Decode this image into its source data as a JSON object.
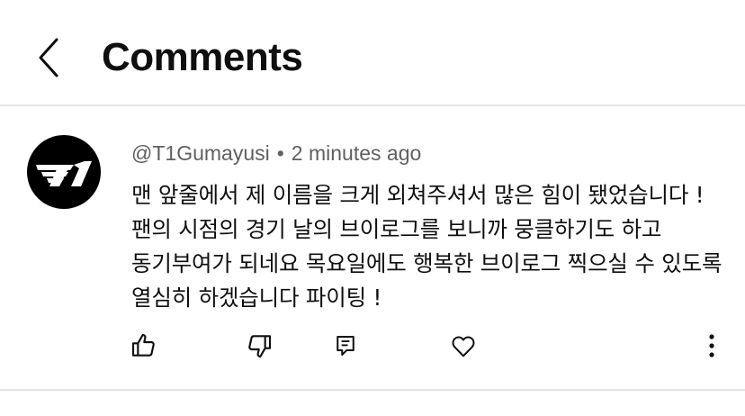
{
  "header": {
    "title": "Comments",
    "back_icon": "chevron-left-icon"
  },
  "comment": {
    "author": "@T1Gumayusi",
    "separator": "•",
    "time": "2 minutes ago",
    "avatar_logo": "t1-logo",
    "text": "맨 앞줄에서 제 이름을 크게 외쳐주셔서 많은 힘이 됐었습니다 ! 팬의 시점의 경기 날의 브이로그를 보니까 뭉클하기도 하고 동기부여가 되네요 목요일에도 행복한 브이로그 찍으실 수 있도록 열심히 하겠습니다 파이팅 !"
  },
  "actions": {
    "like_icon": "thumbs-up-icon",
    "dislike_icon": "thumbs-down-icon",
    "reply_icon": "reply-comment-icon",
    "heart_icon": "heart-icon",
    "more_icon": "more-vertical-icon"
  },
  "colors": {
    "text_primary": "#0f0f0f",
    "text_secondary": "#606060",
    "divider": "#e5e5e5",
    "avatar_bg": "#000000"
  }
}
